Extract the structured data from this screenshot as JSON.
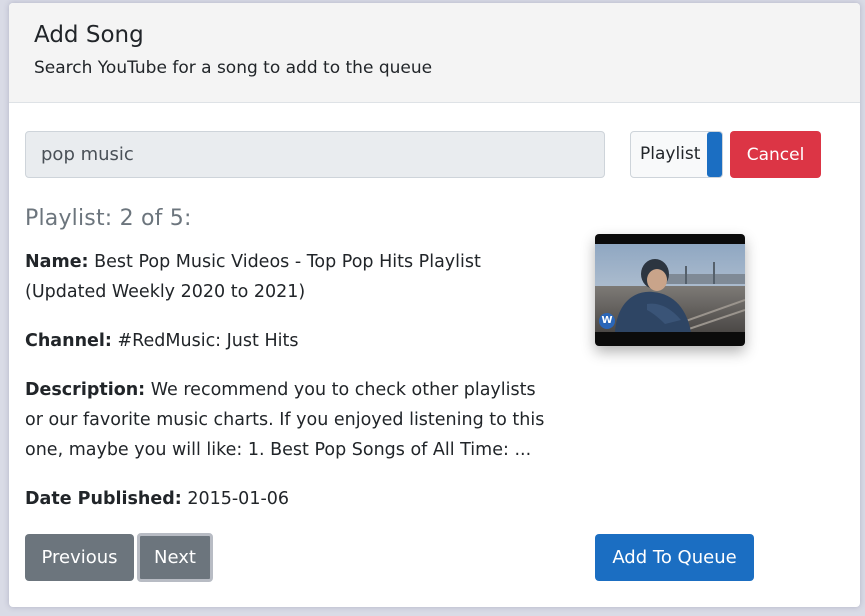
{
  "header": {
    "title": "Add Song",
    "subtitle": "Search YouTube for a song to add to the queue"
  },
  "search": {
    "value": "pop music",
    "toggle_label": "Playlist",
    "cancel_label": "Cancel"
  },
  "result": {
    "heading": "Playlist: 2 of 5:",
    "name_label": "Name:",
    "name": "Best Pop Music Videos - Top Pop Hits Playlist (Updated Weekly 2020 to 2021)",
    "channel_label": "Channel:",
    "channel": "#RedMusic: Just Hits",
    "description_label": "Description:",
    "description": "We recommend you to check other playlists or our favorite music charts. If you enjoyed listening to this one, maybe you will like: 1. Best Pop Songs of All Time: ...",
    "date_label": "Date Published:",
    "date": "2015-01-06",
    "thumbnail_logo": "W"
  },
  "footer": {
    "previous_label": "Previous",
    "next_label": "Next",
    "add_label": "Add To Queue"
  },
  "colors": {
    "primary": "#1b6ec2",
    "danger": "#dc3545",
    "secondary": "#6c757d"
  },
  "icons": {
    "thumbnail_badge": "warner-music-logo-icon"
  }
}
